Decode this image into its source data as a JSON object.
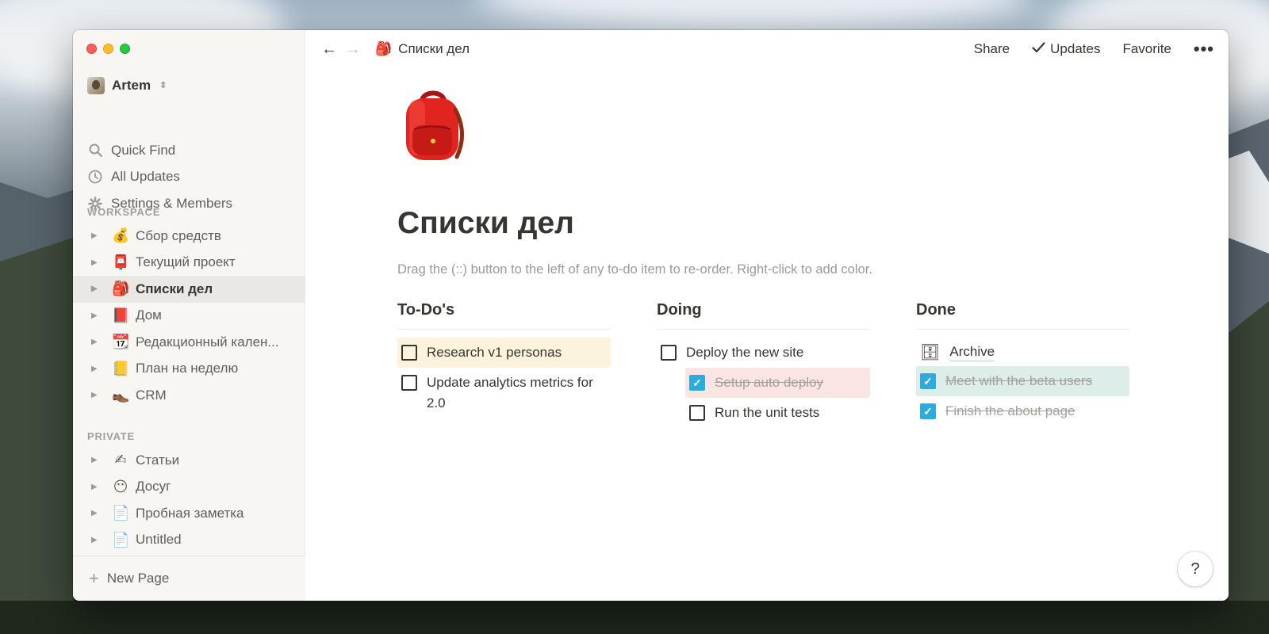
{
  "window": {
    "title": "Списки дел"
  },
  "sidebar": {
    "workspace_name": "Artem",
    "nav": [
      {
        "label": "Quick Find",
        "icon": "search-icon"
      },
      {
        "label": "All Updates",
        "icon": "clock-icon"
      },
      {
        "label": "Settings & Members",
        "icon": "gear-icon"
      }
    ],
    "workspace_label": "WORKSPACE",
    "workspace_pages": [
      {
        "emoji": "💰",
        "label": "Сбор средств"
      },
      {
        "emoji": "📮",
        "label": "Текущий проект"
      },
      {
        "emoji": "🎒",
        "label": "Списки дел",
        "active": true
      },
      {
        "emoji": "📕",
        "label": "Дом"
      },
      {
        "emoji": "📆",
        "label": "Редакционный кален..."
      },
      {
        "emoji": "📒",
        "label": "План на неделю"
      },
      {
        "emoji": "👞",
        "label": "CRM"
      }
    ],
    "private_label": "PRIVATE",
    "private_pages": [
      {
        "emoji": "✍",
        "label": "Статьи"
      },
      {
        "emoji": "😶",
        "label": "Досуг"
      },
      {
        "emoji": "📄",
        "label": "Пробная заметка"
      },
      {
        "emoji": "📄",
        "label": "Untitled"
      }
    ],
    "new_page_label": "New Page"
  },
  "topbar": {
    "breadcrumb_emoji": "🎒",
    "breadcrumb": "Списки дел",
    "share": "Share",
    "updates": "Updates",
    "favorite": "Favorite",
    "more": "•••"
  },
  "page": {
    "title": "Списки дел",
    "hint": "Drag the (::) button to the left of any to-do item to re-order. Right-click to add color.",
    "columns": [
      {
        "heading": "To-Do's",
        "items": [
          {
            "text": "Research v1 personas",
            "checked": false,
            "color": "yellow"
          },
          {
            "text": "Update analytics metrics for 2.0",
            "checked": false
          }
        ]
      },
      {
        "heading": "Doing",
        "items": [
          {
            "text": "Deploy the new site",
            "checked": false
          },
          {
            "text": "Setup auto deploy",
            "checked": true,
            "color": "red",
            "indent": true
          },
          {
            "text": "Run the unit tests",
            "checked": false,
            "indent": true
          }
        ]
      },
      {
        "heading": "Done",
        "archive": {
          "emoji": "🗄",
          "label": "Archive"
        },
        "items": [
          {
            "text": "Meet with the beta users",
            "checked": true,
            "color": "green"
          },
          {
            "text": "Finish the about page",
            "checked": true
          }
        ]
      }
    ]
  },
  "help": "?",
  "colors": {
    "checkbox_checked": "#2eaadc",
    "text": "#37352f",
    "muted": "#9b9a97"
  }
}
